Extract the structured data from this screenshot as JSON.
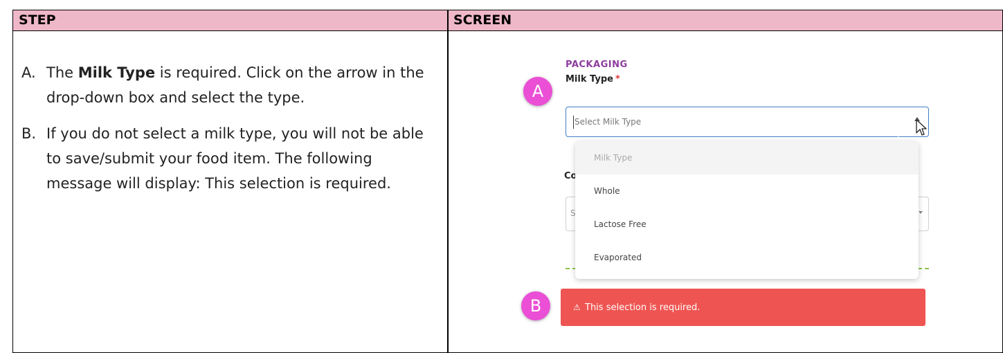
{
  "table": {
    "headers": {
      "step": "STEP",
      "screen": "SCREEN"
    }
  },
  "steps": [
    {
      "marker": "A.",
      "text_before": "The ",
      "bold": "Milk Type",
      "text_after": " is required.  Click on the arrow in the drop-down box and select the type."
    },
    {
      "marker": "B.",
      "text": "If you do not select a milk type, you will not be able to save/submit your food item. The following message will display:  This selection is required."
    }
  ],
  "screen": {
    "section_label": "PACKAGING",
    "field_label": "Milk Type",
    "required_mark": "*",
    "select_placeholder": "Select Milk Type",
    "hidden_field_label_partial": "Co",
    "hidden_select_partial": "S",
    "dropdown": {
      "header": "Milk Type",
      "options": [
        "Whole",
        "Lactose Free",
        "Evaporated"
      ]
    },
    "callouts": {
      "a": "A",
      "b": "B"
    },
    "error": {
      "icon": "warning-icon",
      "symbol": "⚠",
      "message": "This selection is required."
    },
    "colors": {
      "header_bg": "#efb8c9",
      "section_label": "#8e3d9f",
      "callout_badge": "#ea4fd5",
      "error_bg": "#ee5552",
      "select_border": "#3f7fc4",
      "dashed_line": "#8bc34a"
    }
  }
}
